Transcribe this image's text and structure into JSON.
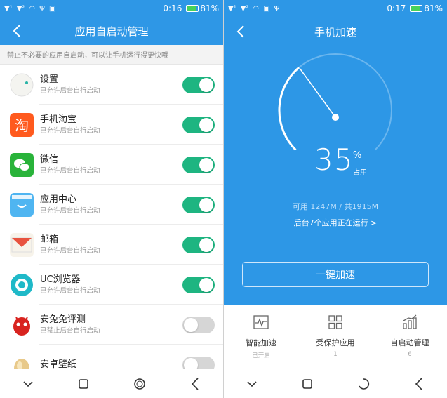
{
  "left": {
    "status": {
      "time": "0:16",
      "battery": "81%",
      "battery_level": 0.81,
      "battery_color": "#48d25a"
    },
    "header": {
      "title": "应用自启动管理"
    },
    "notice": "禁止不必要的应用自启动，可以让手机运行得更快哦",
    "apps": [
      {
        "name": "设置",
        "status": "已允许后台自行启动",
        "enabled": true,
        "icon": "settings-icon"
      },
      {
        "name": "手机淘宝",
        "status": "已允许后台自行启动",
        "enabled": true,
        "icon": "taobao-icon"
      },
      {
        "name": "微信",
        "status": "已允许后台自行启动",
        "enabled": true,
        "icon": "wechat-icon"
      },
      {
        "name": "应用中心",
        "status": "已允许后台自行启动",
        "enabled": true,
        "icon": "app-center-icon"
      },
      {
        "name": "邮箱",
        "status": "已允许后台自行启动",
        "enabled": true,
        "icon": "mail-icon"
      },
      {
        "name": "UC浏览器",
        "status": "已允许后台自行启动",
        "enabled": true,
        "icon": "uc-browser-icon"
      },
      {
        "name": "安兔兔评测",
        "status": "已禁止后台自行启动",
        "enabled": false,
        "icon": "antutu-icon"
      },
      {
        "name": "安卓壁纸",
        "status": "",
        "enabled": false,
        "icon": "wallpaper-icon"
      }
    ]
  },
  "right": {
    "status": {
      "time": "0:17",
      "battery": "81%",
      "battery_level": 0.81
    },
    "header": {
      "title": "手机加速"
    },
    "usage": {
      "percent": "35",
      "percent_value": 35,
      "unit": "%",
      "label": "占用"
    },
    "memory": "可用 1247M / 共1915M",
    "running": "后台7个应用正在运行 >",
    "speedup_button": "一键加速",
    "features": [
      {
        "name": "智能加速",
        "sub": "已开启",
        "icon": "pulse-icon"
      },
      {
        "name": "受保护应用",
        "sub": "1",
        "icon": "grid-icon"
      },
      {
        "name": "自启动管理",
        "sub": "6",
        "icon": "bar-chart-icon"
      }
    ]
  },
  "colors": {
    "accent_blue": "#2e97e6",
    "toggle_on": "#1eb581",
    "toggle_off": "#d6d6d6"
  }
}
